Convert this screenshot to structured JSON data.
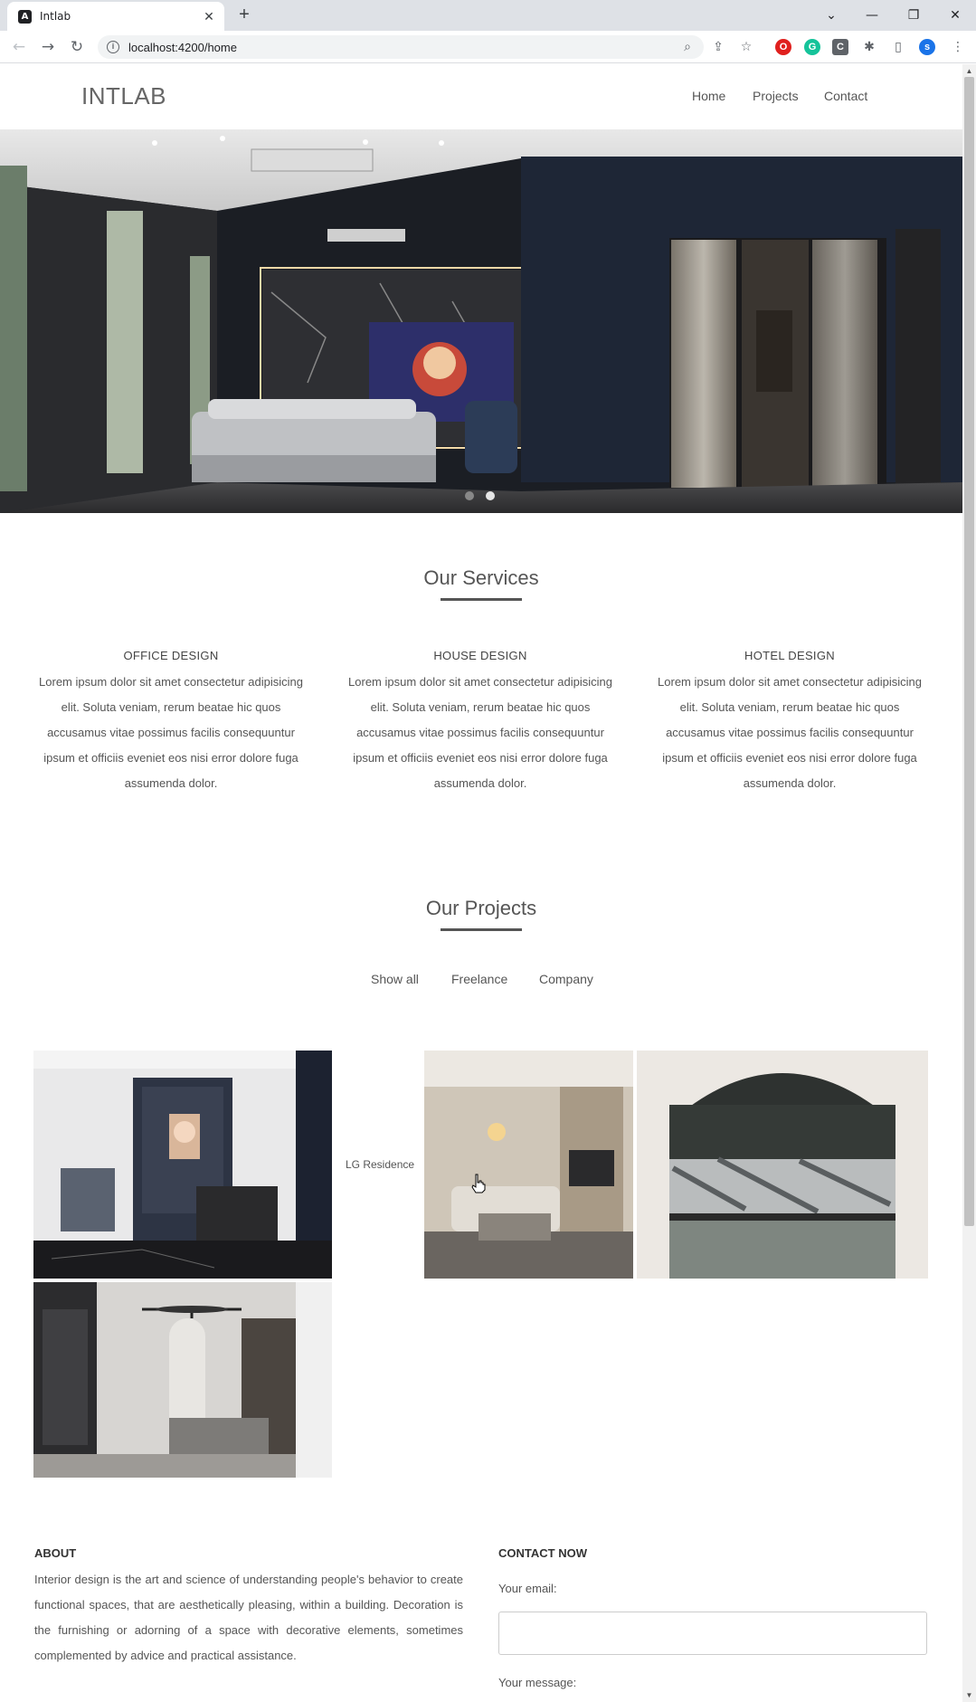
{
  "browser": {
    "tab_title": "Intlab",
    "tab_favicon_letter": "A",
    "new_tab": "+",
    "url": "localhost:4200/home",
    "profile_letter": "s",
    "window_controls": [
      "⌄",
      "—",
      "❐",
      "✕"
    ]
  },
  "header": {
    "logo": "INTLAB",
    "nav": [
      "Home",
      "Projects",
      "Contact"
    ]
  },
  "hero": {
    "slide_count": 2,
    "active_slide": 0
  },
  "services": {
    "title": "Our Services",
    "items": [
      {
        "title": "OFFICE DESIGN",
        "text": "Lorem ipsum dolor sit amet consectetur adipisicing elit. Soluta veniam, rerum beatae hic quos accusamus vitae possimus facilis consequuntur ipsum et officiis eveniet eos nisi error dolore fuga assumenda dolor."
      },
      {
        "title": "HOUSE DESIGN",
        "text": "Lorem ipsum dolor sit amet consectetur adipisicing elit. Soluta veniam, rerum beatae hic quos accusamus vitae possimus facilis consequuntur ipsum et officiis eveniet eos nisi error dolore fuga assumenda dolor."
      },
      {
        "title": "HOTEL DESIGN",
        "text": "Lorem ipsum dolor sit amet consectetur adipisicing elit. Soluta veniam, rerum beatae hic quos accusamus vitae possimus facilis consequuntur ipsum et officiis eveniet eos nisi error dolore fuga assumenda dolor."
      }
    ]
  },
  "projects": {
    "title": "Our Projects",
    "filters": [
      "Show all",
      "Freelance",
      "Company"
    ],
    "hover_caption": "LG Residence"
  },
  "footer": {
    "about_title": "ABOUT",
    "about_text": "Interior design is the art and science of understanding people's behavior to create functional spaces, that are aesthetically pleasing, within a building. Decoration is the furnishing or adorning of a space with decorative elements, sometimes complemented by advice and practical assistance.",
    "contact_title": "CONTACT NOW",
    "email_label": "Your email:",
    "message_label": "Your message:"
  },
  "colors": {
    "text": "#555555",
    "heading_rule": "#555555",
    "dot_active": "#888888",
    "dot_inactive": "#e6e6e6"
  }
}
